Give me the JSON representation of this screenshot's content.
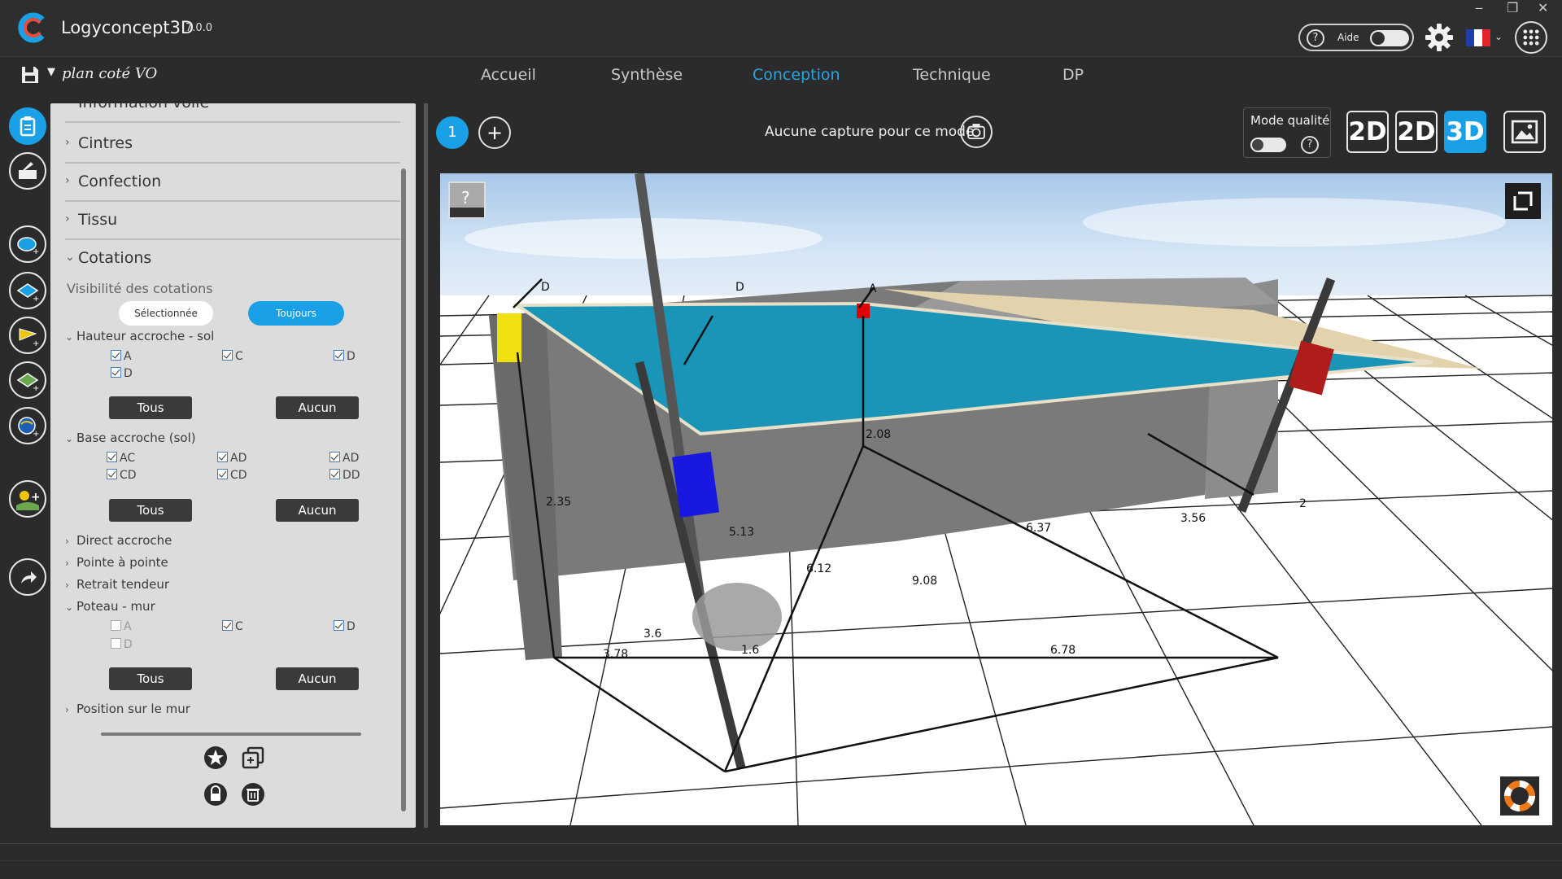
{
  "app": {
    "name": "Logyconcept3D",
    "version": "7.0.0"
  },
  "header": {
    "help_label": "Aide",
    "help_icon": "question-icon",
    "settings_icon": "gear-icon",
    "language_flag": [
      "#1f3fa6",
      "#ffffff",
      "#e3242b"
    ],
    "apps_icon": "grid-icon"
  },
  "project": {
    "name": "plan coté VO"
  },
  "tabs": [
    {
      "label": "Accueil",
      "active": false
    },
    {
      "label": "Synthèse",
      "active": false
    },
    {
      "label": "Conception",
      "active": true
    },
    {
      "label": "Technique",
      "active": false
    },
    {
      "label": "DP",
      "active": false
    }
  ],
  "rail_icons": [
    "clipboard-icon",
    "toolbox-icon",
    "add-shape-icon",
    "add-area-icon",
    "add-flag-icon",
    "add-terrain-icon",
    "add-world-icon",
    "add-sun-icon",
    "share-icon"
  ],
  "panel": {
    "partial_header": "Information voile",
    "sections": [
      "Cintres",
      "Confection",
      "Tissu"
    ],
    "cotations": {
      "title": "Cotations",
      "visibility_label": "Visibilité des cotations",
      "visibility_options": [
        {
          "label": "Sélectionnée",
          "selected": false
        },
        {
          "label": "Toujours",
          "selected": true
        }
      ],
      "hauteur": {
        "title": "Hauteur accroche - sol",
        "items": [
          {
            "label": "A",
            "checked": true
          },
          {
            "label": "C",
            "checked": true
          },
          {
            "label": "D",
            "checked": true
          },
          {
            "label": "D",
            "checked": true
          }
        ],
        "all_label": "Tous",
        "none_label": "Aucun"
      },
      "base": {
        "title": "Base accroche (sol)",
        "items": [
          {
            "label": "AC",
            "checked": true
          },
          {
            "label": "AD",
            "checked": true
          },
          {
            "label": "AD",
            "checked": true
          },
          {
            "label": "CD",
            "checked": true
          },
          {
            "label": "CD",
            "checked": true
          },
          {
            "label": "DD",
            "checked": true
          }
        ],
        "all_label": "Tous",
        "none_label": "Aucun"
      },
      "collapsed": [
        "Direct accroche",
        "Pointe à pointe",
        "Retrait tendeur"
      ],
      "poteau": {
        "title": "Poteau - mur",
        "items": [
          {
            "label": "A",
            "checked": false
          },
          {
            "label": "C",
            "checked": true
          },
          {
            "label": "D",
            "checked": true
          },
          {
            "label": "D",
            "checked": false
          }
        ],
        "all_label": "Tous",
        "none_label": "Aucun"
      },
      "position": "Position sur le mur"
    },
    "footer_icons": [
      "star-icon",
      "duplicate-icon",
      "lock-icon",
      "trash-icon"
    ]
  },
  "viewbar": {
    "page_number": "1",
    "add_label": "+",
    "capture_text": "Aucune capture pour ce mode",
    "mode_label": "Mode qualité",
    "mode_help": "?",
    "view_buttons": [
      {
        "label": "2D",
        "active": false
      },
      {
        "label": "2D",
        "active": false
      },
      {
        "label": "3D",
        "active": true
      }
    ]
  },
  "scene": {
    "help_label": "?",
    "point_labels": [
      "D",
      "D",
      "A"
    ],
    "dimensions": [
      "2.35",
      "2.08",
      "5.13",
      "6.37",
      "3.56",
      "2",
      "6.12",
      "9.08",
      "3.6",
      "3.78",
      "1.6",
      "6.78"
    ]
  }
}
